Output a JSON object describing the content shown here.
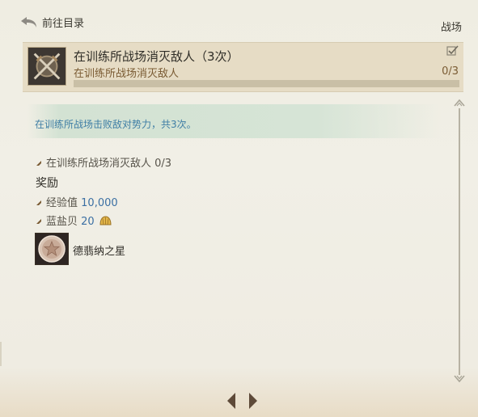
{
  "header": {
    "back_label": "前往目录",
    "category": "战场"
  },
  "quest": {
    "title": "在训练所战场消灭敌人（3次）",
    "subtitle": "在训练所战场消灭敌人",
    "count": "0/3",
    "progress": 0.0
  },
  "description": "在训练所战场击败敌对势力，共3次。",
  "objective": {
    "text": "在训练所战场消灭敌人 0/3"
  },
  "rewards": {
    "title": "奖励",
    "exp_label": "经验值",
    "exp_value": "10,000",
    "currency_label": "蓝盐贝",
    "currency_value": "20",
    "item_name": "德翡纳之星"
  },
  "colors": {
    "accent_blue": "#3b6fa3",
    "description_text": "#3f7ea5",
    "progress_fill": "#7a6546",
    "progress_track": "#c9bfa6"
  },
  "icons": {
    "back": "return-arrow-icon",
    "quest": "crossed-swords-icon",
    "check": "checkbox-checked-icon",
    "shell": "blue-salt-shell-icon",
    "item": "star-medallion-icon"
  }
}
